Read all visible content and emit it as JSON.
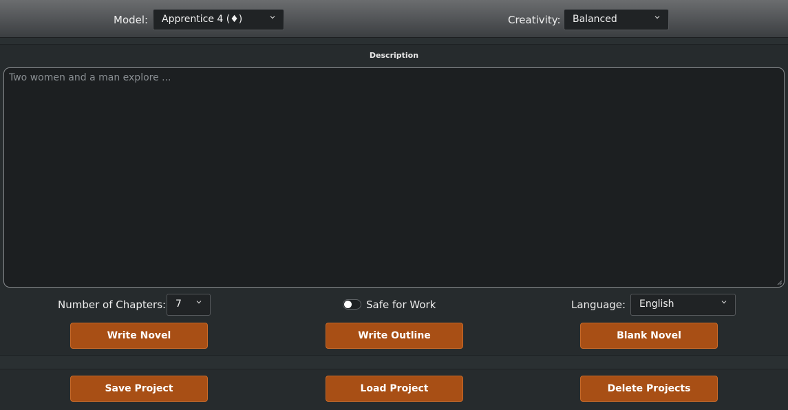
{
  "header": {
    "model_label": "Model:",
    "model_value": "Apprentice 4 (♦)",
    "creativity_label": "Creativity:",
    "creativity_value": "Balanced"
  },
  "description": {
    "title": "Description",
    "placeholder": "Two women and a man explore ..."
  },
  "settings": {
    "chapters_label": "Number of Chapters:",
    "chapters_value": "7",
    "safe_label": "Safe for Work",
    "safe_on": false,
    "language_label": "Language:",
    "language_value": "English"
  },
  "actions": {
    "write_novel": "Write Novel",
    "write_outline": "Write Outline",
    "blank_novel": "Blank Novel"
  },
  "project": {
    "save": "Save Project",
    "load": "Load Project",
    "delete": "Delete Projects"
  },
  "icons": {
    "dropdown": "chevron-down-icon",
    "resize": "resize-handle-icon"
  },
  "colors": {
    "accent": "#a84f15",
    "background": "#262b2d"
  }
}
